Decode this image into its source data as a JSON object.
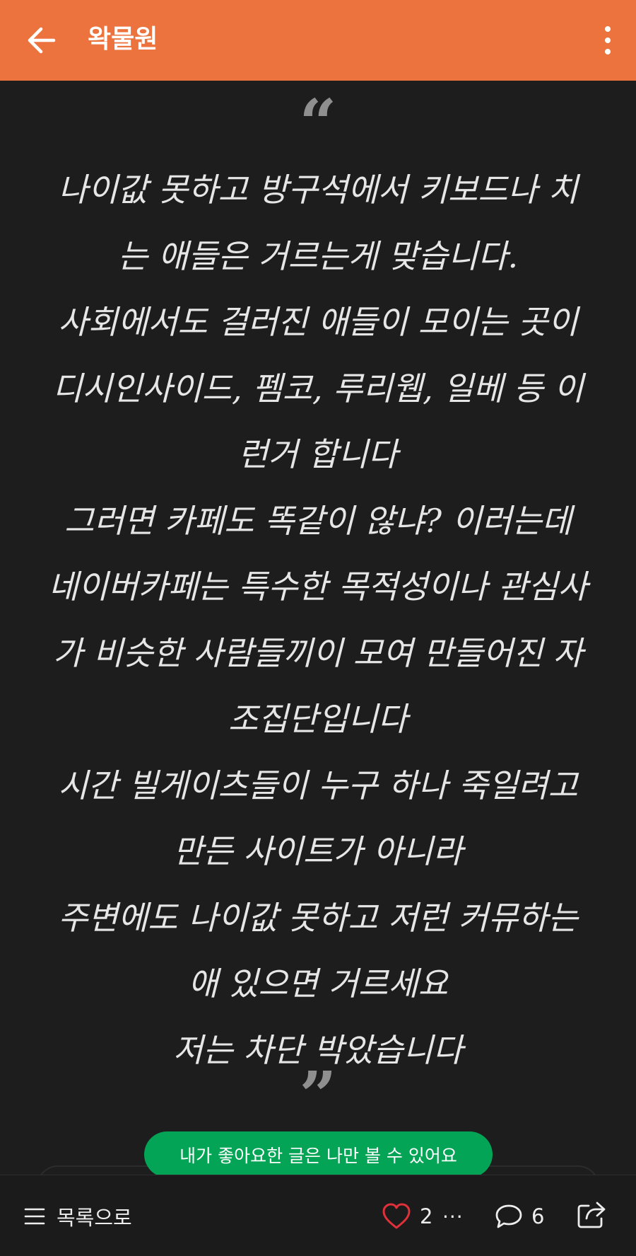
{
  "header": {
    "title": "왁물원",
    "background_color": "#ec733e",
    "back_icon": "arrow-left-icon",
    "more_icon": "more-vertical-icon"
  },
  "post": {
    "quote_open": "“",
    "quote_close": "”",
    "lines": [
      "나이값 못하고 방구석에서 키보드나 치",
      "는 애들은 거르는게 맞습니다.",
      "사회에서도 걸러진 애들이 모이는 곳이",
      "디시인사이드, 펨코, 루리웹, 일베 등 이",
      "런거 합니다",
      "그러면 카페도 똑같이 않냐? 이러는데",
      "네이버카페는 특수한 목적성이나 관심사",
      "가 비슷한 사람들끼이 모여 만들어진 자",
      "조집단입니다",
      "시간 빌게이츠들이 누구 하나 죽일려고",
      "만든 사이트가 아니라",
      "주변에도 나이값 못하고 저런 커뮤하는",
      "애 있으면 거르세요",
      "저는 차단 박았습니다"
    ]
  },
  "toast": {
    "text": "내가 좋아요한 글은 나만 볼 수 있어요",
    "color": "#03a455"
  },
  "bottom_bar": {
    "list_label": "목록으로",
    "list_icon": "list-icon",
    "like_icon": "heart-icon",
    "like_count": "2",
    "more_label": "···",
    "comment_icon": "comment-icon",
    "comment_count": "6",
    "share_icon": "share-icon",
    "heart_color": "#e0313a"
  }
}
